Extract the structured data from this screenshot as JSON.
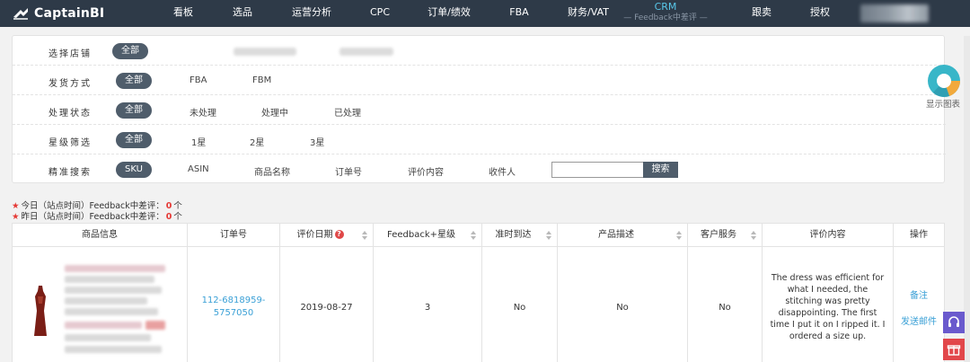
{
  "nav": {
    "logo": "CaptainBI",
    "items": [
      "看板",
      "选品",
      "运营分析",
      "CPC",
      "订单/绩效",
      "FBA",
      "财务/VAT"
    ],
    "crm_label": "CRM",
    "crm_sub": "— Feedback中差评 —",
    "items_right": [
      "跟卖",
      "授权"
    ]
  },
  "filters": {
    "store": {
      "label": "选择店铺",
      "selected": "全部"
    },
    "shipping": {
      "label": "发货方式",
      "selected": "全部",
      "options": [
        "FBA",
        "FBM"
      ]
    },
    "status": {
      "label": "处理状态",
      "selected": "全部",
      "options": [
        "未处理",
        "处理中",
        "已处理"
      ]
    },
    "rating": {
      "label": "星级筛选",
      "selected": "全部",
      "options": [
        "1星",
        "2星",
        "3星"
      ]
    },
    "search": {
      "label": "精准搜索",
      "selected": "SKU",
      "options": [
        "ASIN",
        "商品名称",
        "订单号",
        "评价内容",
        "收件人"
      ],
      "value": "",
      "button": "搜索"
    }
  },
  "side_widget": {
    "label": "显示图表"
  },
  "stats": {
    "today_prefix": "今日（站点时间）Feedback中差评：",
    "today_count": "0",
    "today_unit": "个",
    "yesterday_prefix": "昨日（站点时间）Feedback中差评：",
    "yesterday_count": "0",
    "yesterday_unit": "个"
  },
  "table": {
    "headers": {
      "product": "商品信息",
      "order": "订单号",
      "date": "评价日期",
      "rating": "Feedback+星级",
      "ontime": "准时到达",
      "desc": "产品描述",
      "service": "客户服务",
      "content": "评价内容",
      "action": "操作"
    },
    "row": {
      "order_line1": "112-6818959-",
      "order_line2": "5757050",
      "date": "2019-08-27",
      "rating": "3",
      "ontime": "No",
      "desc": "No",
      "service": "No",
      "content": "The dress was efficient for what I needed, the stitching was pretty disappointing. The first time I put it on I ripped it. I ordered a size up.",
      "action_note": "备注",
      "action_email": "发送邮件"
    }
  },
  "colors": {
    "nav_bg": "#2e3a48",
    "pill_bg": "#4f5d6b",
    "link": "#3aa0d6",
    "accent_red": "#e53935",
    "float_purple": "#6a5acd",
    "float_red": "#e2474b"
  }
}
